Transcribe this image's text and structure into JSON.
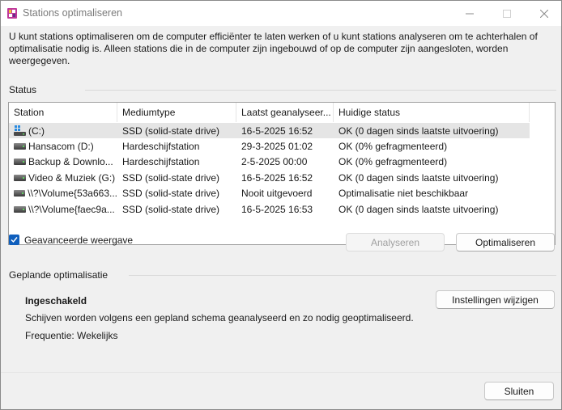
{
  "window": {
    "title": "Stations optimaliseren"
  },
  "intro": {
    "text": "U kunt stations optimaliseren om de computer efficiënter te laten werken of u kunt stations analyseren om te achterhalen of optimalisatie nodig is. Alleen stations die in de computer zijn ingebouwd of op de computer zijn aangesloten, worden weergegeven."
  },
  "status": {
    "label": "Status",
    "columns": [
      "Station",
      "Mediumtype",
      "Laatst geanalyseer...",
      "Huidige status"
    ],
    "rows": [
      {
        "station": "(C:)",
        "media": "SSD (solid-state drive)",
        "last": "16-5-2025 16:52",
        "status": "OK (0 dagen sinds laatste uitvoering)",
        "icon": "windows-drive-icon"
      },
      {
        "station": "Hansacom (D:)",
        "media": "Hardeschijfstation",
        "last": "29-3-2025 01:02",
        "status": "OK (0% gefragmenteerd)",
        "icon": "drive-icon"
      },
      {
        "station": "Backup & Downlo...",
        "media": "Hardeschijfstation",
        "last": "2-5-2025 00:00",
        "status": "OK (0% gefragmenteerd)",
        "icon": "drive-icon"
      },
      {
        "station": "Video & Muziek (G:)",
        "media": "SSD (solid-state drive)",
        "last": "16-5-2025 16:52",
        "status": "OK (0 dagen sinds laatste uitvoering)",
        "icon": "drive-icon"
      },
      {
        "station": "\\\\?\\Volume{53a663...",
        "media": "SSD (solid-state drive)",
        "last": "Nooit uitgevoerd",
        "status": "Optimalisatie niet beschikbaar",
        "icon": "drive-icon"
      },
      {
        "station": "\\\\?\\Volume{faec9a...",
        "media": "SSD (solid-state drive)",
        "last": "16-5-2025 16:53",
        "status": "OK (0 dagen sinds laatste uitvoering)",
        "icon": "drive-icon"
      }
    ],
    "advanced_view_label": "Geavanceerde weergave",
    "analyze_label": "Analyseren",
    "optimize_label": "Optimaliseren"
  },
  "scheduled": {
    "label": "Geplande optimalisatie",
    "state": "Ingeschakeld",
    "description": "Schijven worden volgens een gepland schema geanalyseerd en zo nodig geoptimaliseerd.",
    "frequency": "Frequentie: Wekelijks",
    "change_settings_label": "Instellingen wijzigen"
  },
  "footer": {
    "close_label": "Sluiten"
  },
  "colors": {
    "accent": "#0f5fbd",
    "selection": "#e5e5e5"
  }
}
